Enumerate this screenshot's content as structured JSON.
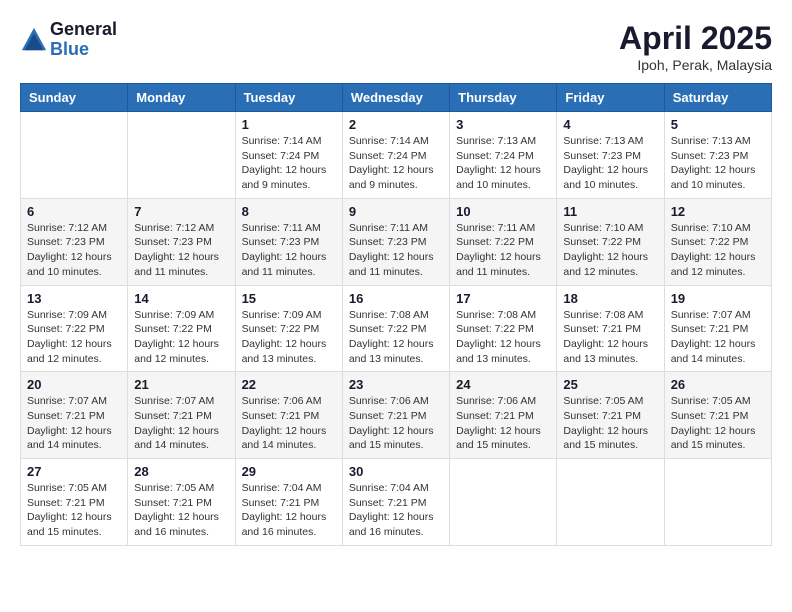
{
  "header": {
    "logo_general": "General",
    "logo_blue": "Blue",
    "title": "April 2025",
    "location": "Ipoh, Perak, Malaysia"
  },
  "days_of_week": [
    "Sunday",
    "Monday",
    "Tuesday",
    "Wednesday",
    "Thursday",
    "Friday",
    "Saturday"
  ],
  "weeks": [
    [
      {
        "day": "",
        "info": ""
      },
      {
        "day": "",
        "info": ""
      },
      {
        "day": "1",
        "sunrise": "Sunrise: 7:14 AM",
        "sunset": "Sunset: 7:24 PM",
        "daylight": "Daylight: 12 hours and 9 minutes."
      },
      {
        "day": "2",
        "sunrise": "Sunrise: 7:14 AM",
        "sunset": "Sunset: 7:24 PM",
        "daylight": "Daylight: 12 hours and 9 minutes."
      },
      {
        "day": "3",
        "sunrise": "Sunrise: 7:13 AM",
        "sunset": "Sunset: 7:24 PM",
        "daylight": "Daylight: 12 hours and 10 minutes."
      },
      {
        "day": "4",
        "sunrise": "Sunrise: 7:13 AM",
        "sunset": "Sunset: 7:23 PM",
        "daylight": "Daylight: 12 hours and 10 minutes."
      },
      {
        "day": "5",
        "sunrise": "Sunrise: 7:13 AM",
        "sunset": "Sunset: 7:23 PM",
        "daylight": "Daylight: 12 hours and 10 minutes."
      }
    ],
    [
      {
        "day": "6",
        "sunrise": "Sunrise: 7:12 AM",
        "sunset": "Sunset: 7:23 PM",
        "daylight": "Daylight: 12 hours and 10 minutes."
      },
      {
        "day": "7",
        "sunrise": "Sunrise: 7:12 AM",
        "sunset": "Sunset: 7:23 PM",
        "daylight": "Daylight: 12 hours and 11 minutes."
      },
      {
        "day": "8",
        "sunrise": "Sunrise: 7:11 AM",
        "sunset": "Sunset: 7:23 PM",
        "daylight": "Daylight: 12 hours and 11 minutes."
      },
      {
        "day": "9",
        "sunrise": "Sunrise: 7:11 AM",
        "sunset": "Sunset: 7:23 PM",
        "daylight": "Daylight: 12 hours and 11 minutes."
      },
      {
        "day": "10",
        "sunrise": "Sunrise: 7:11 AM",
        "sunset": "Sunset: 7:22 PM",
        "daylight": "Daylight: 12 hours and 11 minutes."
      },
      {
        "day": "11",
        "sunrise": "Sunrise: 7:10 AM",
        "sunset": "Sunset: 7:22 PM",
        "daylight": "Daylight: 12 hours and 12 minutes."
      },
      {
        "day": "12",
        "sunrise": "Sunrise: 7:10 AM",
        "sunset": "Sunset: 7:22 PM",
        "daylight": "Daylight: 12 hours and 12 minutes."
      }
    ],
    [
      {
        "day": "13",
        "sunrise": "Sunrise: 7:09 AM",
        "sunset": "Sunset: 7:22 PM",
        "daylight": "Daylight: 12 hours and 12 minutes."
      },
      {
        "day": "14",
        "sunrise": "Sunrise: 7:09 AM",
        "sunset": "Sunset: 7:22 PM",
        "daylight": "Daylight: 12 hours and 12 minutes."
      },
      {
        "day": "15",
        "sunrise": "Sunrise: 7:09 AM",
        "sunset": "Sunset: 7:22 PM",
        "daylight": "Daylight: 12 hours and 13 minutes."
      },
      {
        "day": "16",
        "sunrise": "Sunrise: 7:08 AM",
        "sunset": "Sunset: 7:22 PM",
        "daylight": "Daylight: 12 hours and 13 minutes."
      },
      {
        "day": "17",
        "sunrise": "Sunrise: 7:08 AM",
        "sunset": "Sunset: 7:22 PM",
        "daylight": "Daylight: 12 hours and 13 minutes."
      },
      {
        "day": "18",
        "sunrise": "Sunrise: 7:08 AM",
        "sunset": "Sunset: 7:21 PM",
        "daylight": "Daylight: 12 hours and 13 minutes."
      },
      {
        "day": "19",
        "sunrise": "Sunrise: 7:07 AM",
        "sunset": "Sunset: 7:21 PM",
        "daylight": "Daylight: 12 hours and 14 minutes."
      }
    ],
    [
      {
        "day": "20",
        "sunrise": "Sunrise: 7:07 AM",
        "sunset": "Sunset: 7:21 PM",
        "daylight": "Daylight: 12 hours and 14 minutes."
      },
      {
        "day": "21",
        "sunrise": "Sunrise: 7:07 AM",
        "sunset": "Sunset: 7:21 PM",
        "daylight": "Daylight: 12 hours and 14 minutes."
      },
      {
        "day": "22",
        "sunrise": "Sunrise: 7:06 AM",
        "sunset": "Sunset: 7:21 PM",
        "daylight": "Daylight: 12 hours and 14 minutes."
      },
      {
        "day": "23",
        "sunrise": "Sunrise: 7:06 AM",
        "sunset": "Sunset: 7:21 PM",
        "daylight": "Daylight: 12 hours and 15 minutes."
      },
      {
        "day": "24",
        "sunrise": "Sunrise: 7:06 AM",
        "sunset": "Sunset: 7:21 PM",
        "daylight": "Daylight: 12 hours and 15 minutes."
      },
      {
        "day": "25",
        "sunrise": "Sunrise: 7:05 AM",
        "sunset": "Sunset: 7:21 PM",
        "daylight": "Daylight: 12 hours and 15 minutes."
      },
      {
        "day": "26",
        "sunrise": "Sunrise: 7:05 AM",
        "sunset": "Sunset: 7:21 PM",
        "daylight": "Daylight: 12 hours and 15 minutes."
      }
    ],
    [
      {
        "day": "27",
        "sunrise": "Sunrise: 7:05 AM",
        "sunset": "Sunset: 7:21 PM",
        "daylight": "Daylight: 12 hours and 15 minutes."
      },
      {
        "day": "28",
        "sunrise": "Sunrise: 7:05 AM",
        "sunset": "Sunset: 7:21 PM",
        "daylight": "Daylight: 12 hours and 16 minutes."
      },
      {
        "day": "29",
        "sunrise": "Sunrise: 7:04 AM",
        "sunset": "Sunset: 7:21 PM",
        "daylight": "Daylight: 12 hours and 16 minutes."
      },
      {
        "day": "30",
        "sunrise": "Sunrise: 7:04 AM",
        "sunset": "Sunset: 7:21 PM",
        "daylight": "Daylight: 12 hours and 16 minutes."
      },
      {
        "day": "",
        "info": ""
      },
      {
        "day": "",
        "info": ""
      },
      {
        "day": "",
        "info": ""
      }
    ]
  ]
}
